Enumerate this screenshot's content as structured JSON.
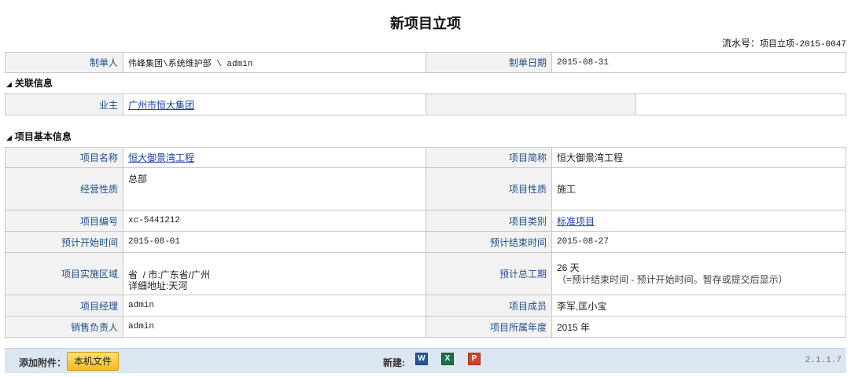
{
  "title": "新项目立项",
  "serial": {
    "label": "流水号：",
    "value": "项目立项-2015-0047"
  },
  "top": {
    "creator_label": "制单人",
    "creator_value": "伟峰集团\\系统维护部 \\ admin",
    "date_label": "制单日期",
    "date_value": "2015-08-31"
  },
  "related": {
    "title": "关联信息",
    "owner_label": "业主",
    "owner_value": "广州市恒大集团"
  },
  "basic": {
    "title": "项目基本信息",
    "name_label": "项目名称",
    "name_value": "恒大御景湾工程",
    "short_label": "项目简称",
    "short_value": "恒大御景湾工程",
    "nature_label": "经营性质",
    "nature_value": "总部",
    "prop_label": "项目性质",
    "prop_value": "施工",
    "code_label": "项目编号",
    "code_value": "xc-5441212",
    "category_label": "项目类别",
    "category_value": "标准项目",
    "start_label": "预计开始时间",
    "start_value": "2015-08-01",
    "end_label": "预计结束时间",
    "end_value": "2015-08-27",
    "area_label": "项目实施区域",
    "area_line1": "省  / 市:广东省/广州",
    "area_line2": "详细地址:天河",
    "duration_label": "预计总工期",
    "duration_value": "26 天",
    "duration_note": "（=预计结束时间 - 预计开始时间。暂存或提交后显示）",
    "manager_label": "项目经理",
    "manager_value": "admin",
    "members_label": "项目成员",
    "members_value": "李军,匡小宝",
    "sales_label": "销售负责人",
    "sales_value": "admin",
    "year_label": "项目所属年度",
    "year_value": "2015 年"
  },
  "attach": {
    "label": "添加附件：",
    "local_button": "本机文件",
    "new_label": "新建:",
    "word_letter": "W",
    "excel_letter": "X",
    "ppt_letter": "P",
    "version": "2.1.1.7"
  },
  "colors": {
    "label_text": "#1f4e8c",
    "link": "#1a3fa6",
    "label_bg": "#f2f2f2",
    "attach_bg": "#dce6f2",
    "button": "#f5bb1c",
    "word": "#2b5797",
    "excel": "#1e7145",
    "ppt": "#d24726"
  }
}
